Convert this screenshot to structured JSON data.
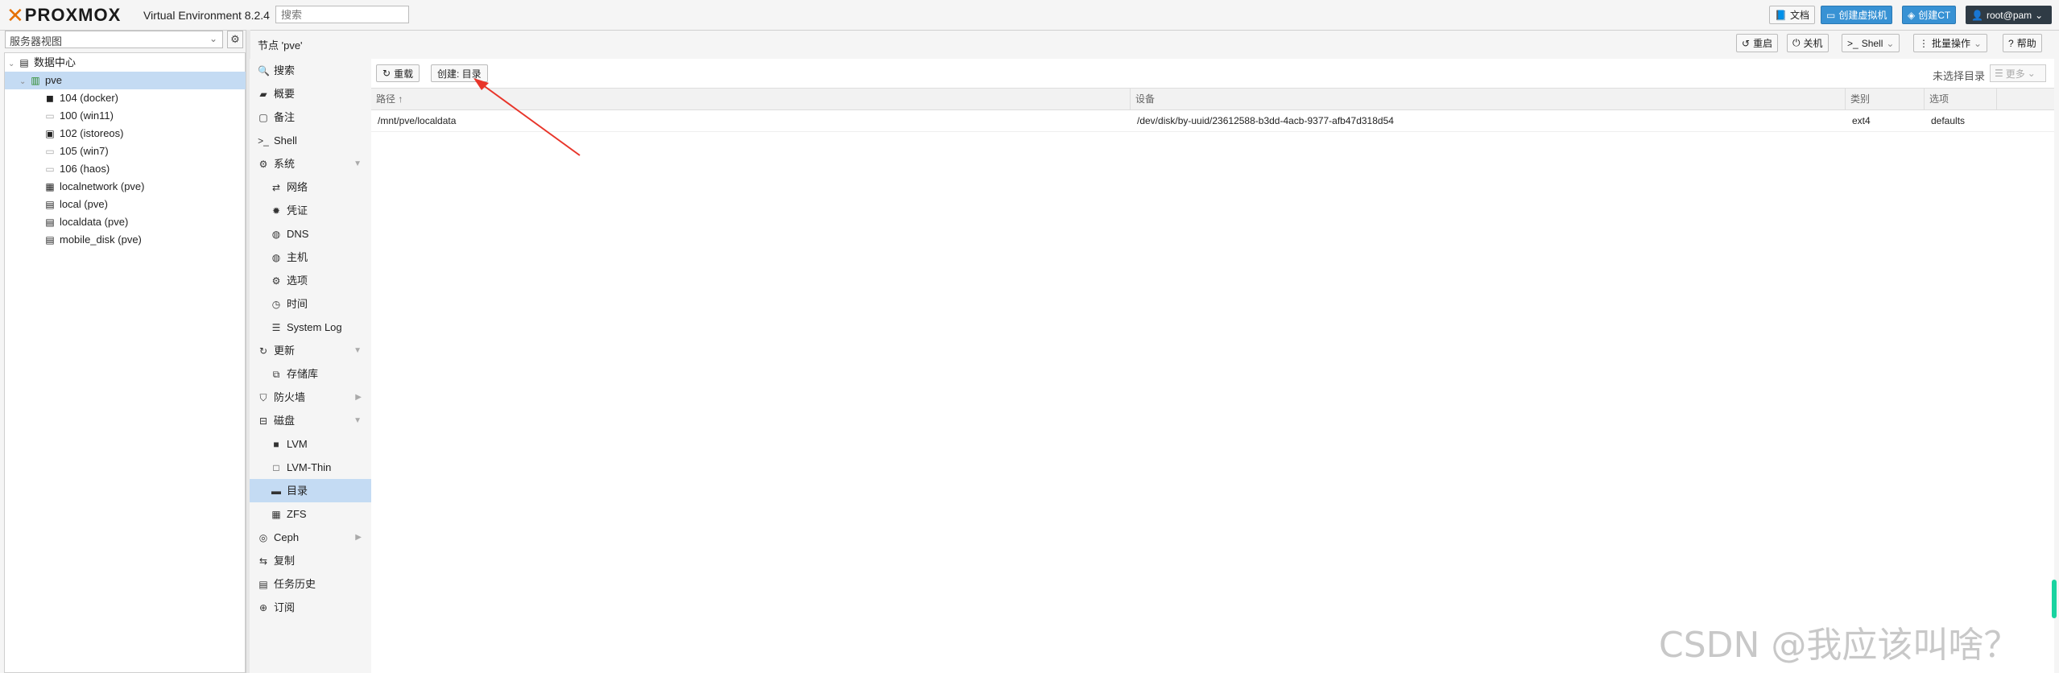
{
  "app": {
    "logo_text": "PROXMOX",
    "version": "Virtual Environment 8.2.4",
    "search_placeholder": "搜索"
  },
  "top_buttons": {
    "docs": "文档",
    "create_vm": "创建虚拟机",
    "create_ct": "创建CT",
    "user": "root@pam"
  },
  "left": {
    "view_select": "服务器视图",
    "tree": [
      {
        "label": "数据中心",
        "icon": "datacenter-icon"
      },
      {
        "label": "pve",
        "icon": "node-icon"
      },
      {
        "label": "104 (docker)",
        "icon": "container-running-icon"
      },
      {
        "label": "100 (win11)",
        "icon": "vm-stopped-icon"
      },
      {
        "label": "102 (istoreos)",
        "icon": "vm-running-icon"
      },
      {
        "label": "105 (win7)",
        "icon": "vm-stopped-icon"
      },
      {
        "label": "106 (haos)",
        "icon": "vm-stopped-icon"
      },
      {
        "label": "localnetwork (pve)",
        "icon": "network-icon"
      },
      {
        "label": "local (pve)",
        "icon": "storage-icon"
      },
      {
        "label": "localdata (pve)",
        "icon": "storage-icon"
      },
      {
        "label": "mobile_disk (pve)",
        "icon": "storage-icon"
      }
    ]
  },
  "node_header": {
    "title": "节点 'pve'",
    "reboot": "重启",
    "shutdown": "关机",
    "shell": "Shell",
    "bulk": "批量操作",
    "help": "帮助"
  },
  "nav": [
    {
      "label": "搜索",
      "icon": "search-icon"
    },
    {
      "label": "概要",
      "icon": "book-icon"
    },
    {
      "label": "备注",
      "icon": "note-icon"
    },
    {
      "label": "Shell",
      "icon": "terminal-icon"
    },
    {
      "label": "系统",
      "icon": "cogs-icon"
    },
    {
      "label": "网络",
      "icon": "exchange-icon"
    },
    {
      "label": "凭证",
      "icon": "certificate-icon"
    },
    {
      "label": "DNS",
      "icon": "globe-icon"
    },
    {
      "label": "主机",
      "icon": "globe-icon"
    },
    {
      "label": "选项",
      "icon": "gear-icon"
    },
    {
      "label": "时间",
      "icon": "clock-icon"
    },
    {
      "label": "System Log",
      "icon": "list-icon"
    },
    {
      "label": "更新",
      "icon": "refresh-icon"
    },
    {
      "label": "存储库",
      "icon": "files-icon"
    },
    {
      "label": "防火墙",
      "icon": "shield-icon"
    },
    {
      "label": "磁盘",
      "icon": "hdd-icon"
    },
    {
      "label": "LVM",
      "icon": "square-icon"
    },
    {
      "label": "LVM-Thin",
      "icon": "square-outline-icon"
    },
    {
      "label": "目录",
      "icon": "folder-icon"
    },
    {
      "label": "ZFS",
      "icon": "th-large-icon"
    },
    {
      "label": "Ceph",
      "icon": "ceph-icon"
    },
    {
      "label": "复制",
      "icon": "retweet-icon"
    },
    {
      "label": "任务历史",
      "icon": "list-alt-icon"
    },
    {
      "label": "订阅",
      "icon": "support-icon"
    }
  ],
  "content": {
    "reload_button": "重载",
    "create_button": "创建: 目录",
    "no_selection": "未选择目录",
    "more_button": "更多",
    "columns": [
      "路径 ↑",
      "设备",
      "类别",
      "选项"
    ],
    "rows": [
      [
        "/mnt/pve/localdata",
        "/dev/disk/by-uuid/23612588-b3dd-4acb-9377-afb47d318d54",
        "ext4",
        "defaults"
      ]
    ]
  },
  "watermark": "CSDN @我应该叫啥？",
  "colors": {
    "accent": "#3892d4",
    "selected": "#c4dbf3",
    "logo_orange": "#e57000",
    "annotation_red": "#e8352a"
  }
}
